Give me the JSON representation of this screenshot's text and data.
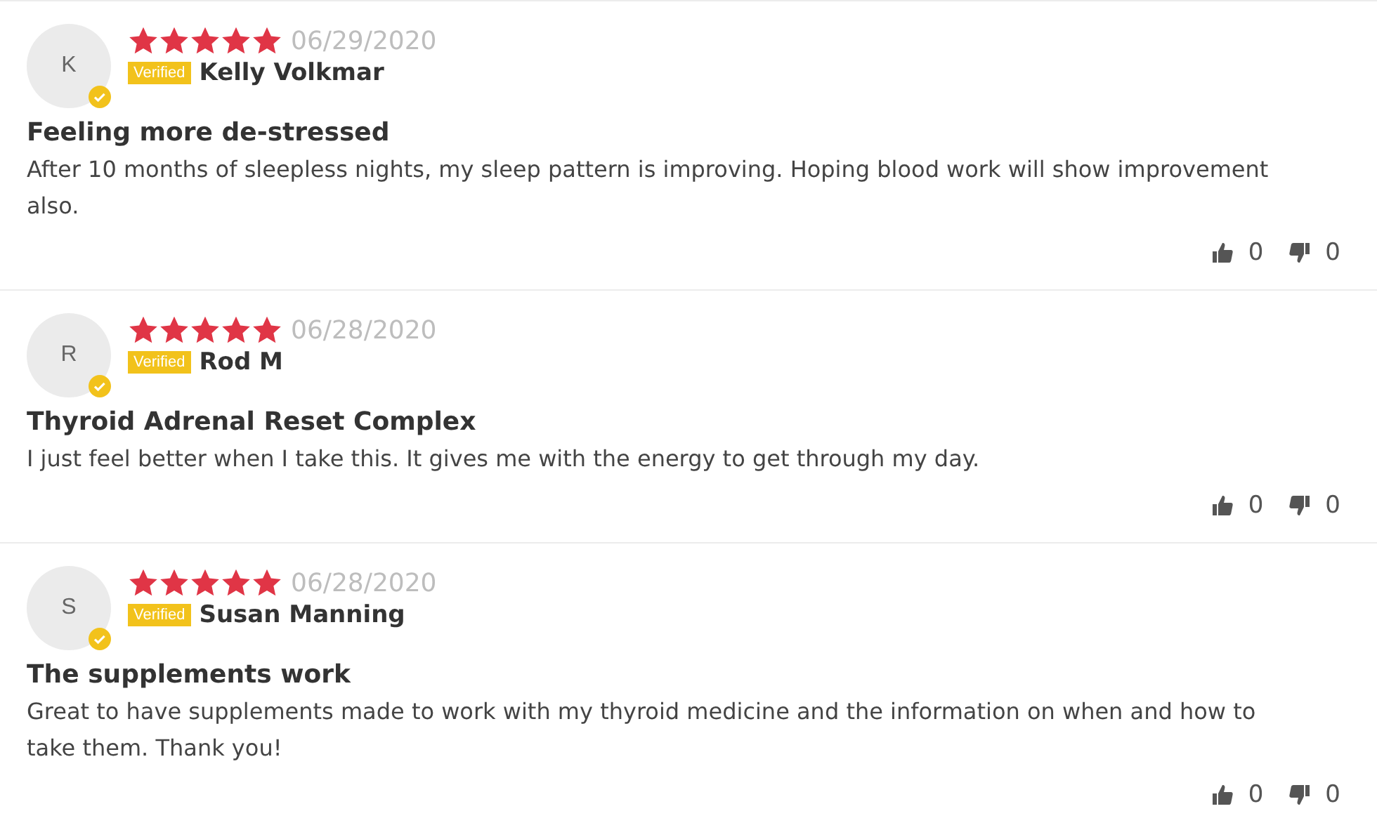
{
  "reviews": [
    {
      "initial": "K",
      "stars": 5,
      "date": "06/29/2020",
      "badge": "Verified",
      "name": "Kelly Volkmar",
      "title": "Feeling more de-stressed",
      "body": "After 10 months of sleepless nights, my sleep pattern is improving. Hoping blood work will show improvement also.",
      "upvotes": "0",
      "downvotes": "0"
    },
    {
      "initial": "R",
      "stars": 5,
      "date": "06/28/2020",
      "badge": "Verified",
      "name": "Rod M",
      "title": "Thyroid Adrenal Reset Complex",
      "body": "I just feel better when I take this. It gives me with the energy to get through my day.",
      "upvotes": "0",
      "downvotes": "0"
    },
    {
      "initial": "S",
      "stars": 5,
      "date": "06/28/2020",
      "badge": "Verified",
      "name": "Susan Manning",
      "title": "The supplements work",
      "body": "Great to have supplements made to work with my thyroid medicine and the information on when and how to take them. Thank you!",
      "upvotes": "0",
      "downvotes": "0"
    }
  ]
}
